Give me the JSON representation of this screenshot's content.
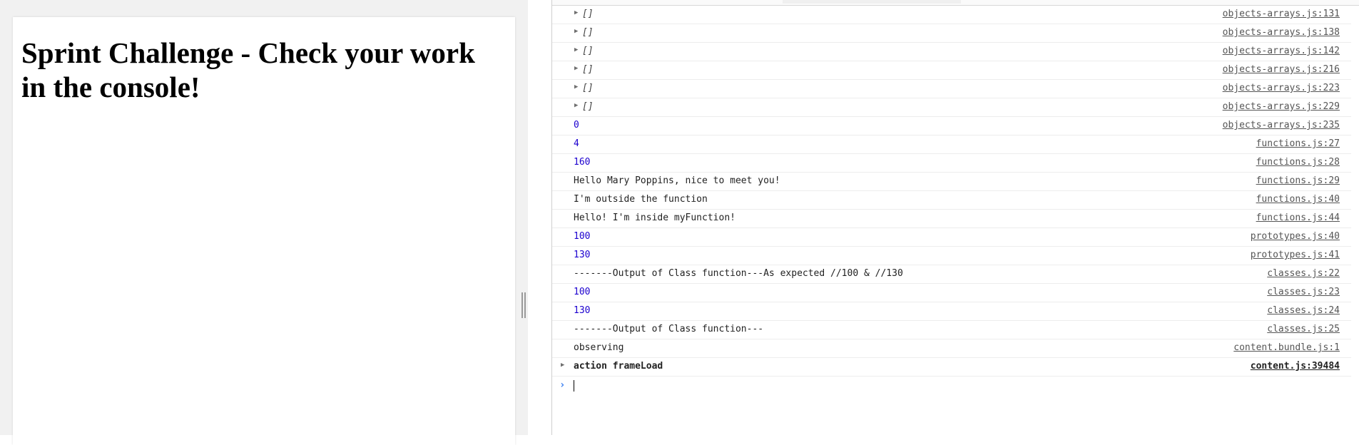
{
  "page": {
    "title": "Sprint Challenge - Check your work in the console!"
  },
  "console": {
    "rows": [
      {
        "message": "[]",
        "kind": "array",
        "source": "objects-arrays.js:131"
      },
      {
        "message": "[]",
        "kind": "array",
        "source": "objects-arrays.js:138"
      },
      {
        "message": "[]",
        "kind": "array",
        "source": "objects-arrays.js:142"
      },
      {
        "message": "[]",
        "kind": "array",
        "source": "objects-arrays.js:216"
      },
      {
        "message": "[]",
        "kind": "array",
        "source": "objects-arrays.js:223"
      },
      {
        "message": "[]",
        "kind": "array",
        "source": "objects-arrays.js:229"
      },
      {
        "message": "0",
        "kind": "number",
        "source": "objects-arrays.js:235"
      },
      {
        "message": "4",
        "kind": "number",
        "source": "functions.js:27"
      },
      {
        "message": "160",
        "kind": "number",
        "source": "functions.js:28"
      },
      {
        "message": "Hello Mary Poppins, nice to meet you!",
        "kind": "string",
        "source": "functions.js:29"
      },
      {
        "message": "I'm outside the function",
        "kind": "string",
        "source": "functions.js:40"
      },
      {
        "message": "Hello! I'm inside myFunction!",
        "kind": "string",
        "source": "functions.js:44"
      },
      {
        "message": "100",
        "kind": "number",
        "source": "prototypes.js:40"
      },
      {
        "message": "130",
        "kind": "number",
        "source": "prototypes.js:41"
      },
      {
        "message": "-------Output of Class function---As expected //100 & //130",
        "kind": "string",
        "source": "classes.js:22"
      },
      {
        "message": "100",
        "kind": "number",
        "source": "classes.js:23"
      },
      {
        "message": "130",
        "kind": "number",
        "source": "classes.js:24"
      },
      {
        "message": "-------Output of Class function---",
        "kind": "string",
        "source": "classes.js:25"
      },
      {
        "message": "observing",
        "kind": "string",
        "source": "content.bundle.js:1"
      },
      {
        "message": "action frameLoad",
        "kind": "group",
        "source": "content.js:39484"
      }
    ],
    "prompt_icon": "chevron-right-icon"
  }
}
